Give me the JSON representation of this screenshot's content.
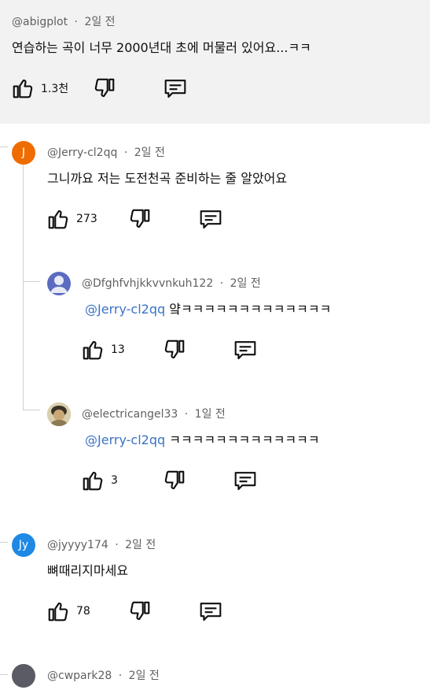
{
  "comments": [
    {
      "author": "@abigplot",
      "time": "2일 전",
      "text": "연습하는 곡이 너무 2000년대 초에 머물러 있어요...ㅋㅋ",
      "likes": "1.3천"
    },
    {
      "author": "@Jerry-cl2qq",
      "time": "2일 전",
      "text": "그니까요 저는 도전천곡 준비하는 줄 알았어요",
      "likes": "273",
      "avatar_letter": "J",
      "avatar_color": "#ef6c00"
    },
    {
      "author": "@Dfghfvhjkkvvnkuh122",
      "time": "2일 전",
      "mention": "@Jerry-cl2qq",
      "text": "얔ㅋㅋㅋㅋㅋㅋㅋㅋㅋㅋㅋㅋㅋ",
      "likes": "13",
      "avatar_color": "#5c6bc0"
    },
    {
      "author": "@electricangel33",
      "time": "1일 전",
      "mention": "@Jerry-cl2qq",
      "text": "ㅋㅋㅋㅋㅋㅋㅋㅋㅋㅋㅋㅋㅋ",
      "likes": "3"
    },
    {
      "author": "@jyyyy174",
      "time": "2일 전",
      "text": "뼈때리지마세요",
      "likes": "78",
      "avatar_letter": "Jy",
      "avatar_color": "#1e88e5"
    },
    {
      "author": "@cwpark28",
      "time": "2일 전"
    }
  ],
  "meta_sep": "·",
  "icons": {
    "like": "thumbs-up-icon",
    "dislike": "thumbs-down-icon",
    "reply": "reply-comment-icon"
  }
}
